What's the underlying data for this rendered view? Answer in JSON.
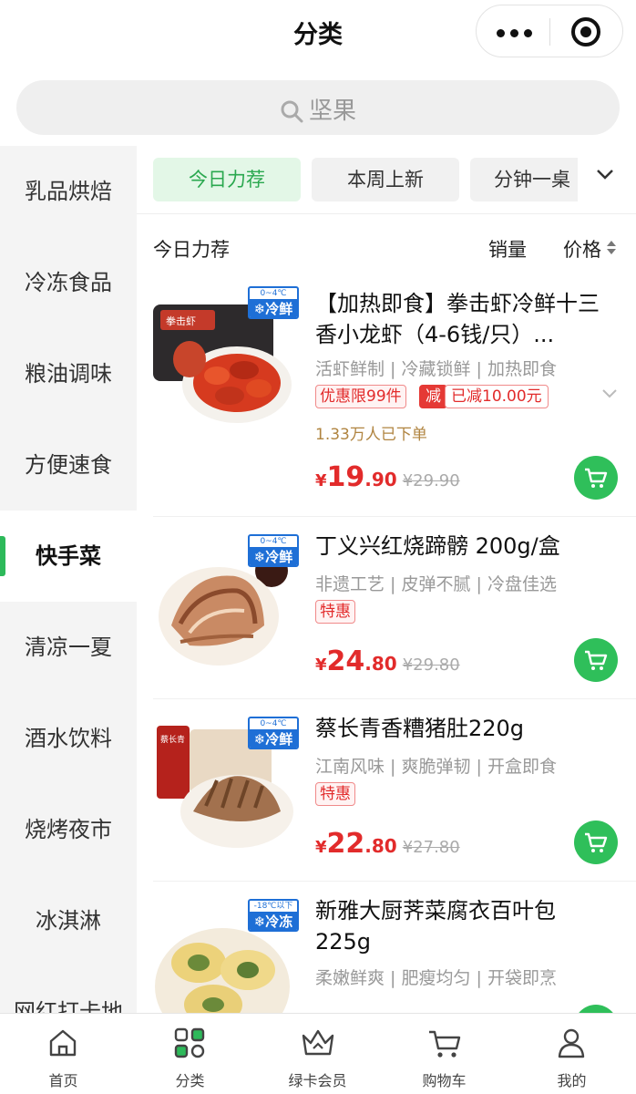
{
  "header": {
    "title": "分类"
  },
  "search": {
    "placeholder": "坚果"
  },
  "sidebar": {
    "items": [
      {
        "label": "乳品烘焙"
      },
      {
        "label": "冷冻食品"
      },
      {
        "label": "粮油调味"
      },
      {
        "label": "方便速食"
      },
      {
        "label": "快手菜",
        "active": true
      },
      {
        "label": "清凉一夏"
      },
      {
        "label": "酒水饮料"
      },
      {
        "label": "烧烤夜市"
      },
      {
        "label": "冰淇淋"
      },
      {
        "label": "网红打卡地"
      }
    ]
  },
  "tabs": [
    {
      "label": "今日力荐",
      "active": true
    },
    {
      "label": "本周上新"
    },
    {
      "label": "分钟一桌"
    }
  ],
  "sort": {
    "section": "今日力荐",
    "sales": "销量",
    "price": "价格"
  },
  "products": [
    {
      "name": "【加热即食】拳击虾冷鲜十三香小龙虾（4-6钱/只）...",
      "desc": "活虾鲜制 | 冷藏锁鲜 | 加热即食",
      "badge_temp": "0~4℃",
      "badge_kind": "❄冷鲜",
      "tags": [
        "优惠限99件",
        "减"
      ],
      "reduce": "已减10.00元",
      "sold": "1.33万人已下单",
      "price_yen": "¥",
      "price_int": "19",
      "price_dec": ".90",
      "old_price": "¥29.90",
      "thumb_text": "拳击虾"
    },
    {
      "name": "丁义兴红烧蹄髈 200g/盒",
      "desc": "非遗工艺 | 皮弹不腻 | 冷盘佳选",
      "badge_temp": "0~4℃",
      "badge_kind": "❄冷鲜",
      "tags": [
        "特惠"
      ],
      "price_yen": "¥",
      "price_int": "24",
      "price_dec": ".80",
      "old_price": "¥29.80"
    },
    {
      "name": "蔡长青香糟猪肚220g",
      "desc": "江南风味 | 爽脆弹韧 | 开盒即食",
      "badge_temp": "0~4℃",
      "badge_kind": "❄冷鲜",
      "tags": [
        "特惠"
      ],
      "price_yen": "¥",
      "price_int": "22",
      "price_dec": ".80",
      "old_price": "¥27.80",
      "thumb_text": "蔡长青"
    },
    {
      "name": "新雅大厨荠菜腐衣百叶包 225g",
      "desc": "柔嫩鲜爽 | 肥瘦均匀 | 开袋即烹",
      "badge_temp": "-18℃以下",
      "badge_kind": "❄冷冻"
    }
  ],
  "bottom_nav": [
    {
      "label": "首页",
      "icon": "home-icon"
    },
    {
      "label": "分类",
      "icon": "category-icon",
      "active": true
    },
    {
      "label": "绿卡会员",
      "icon": "crown-icon"
    },
    {
      "label": "购物车",
      "icon": "cart-icon"
    },
    {
      "label": "我的",
      "icon": "user-icon"
    }
  ],
  "colors": {
    "accent": "#2db95a",
    "price": "#e22b2b",
    "badge": "#1e6fd6",
    "sold": "#b08440"
  }
}
